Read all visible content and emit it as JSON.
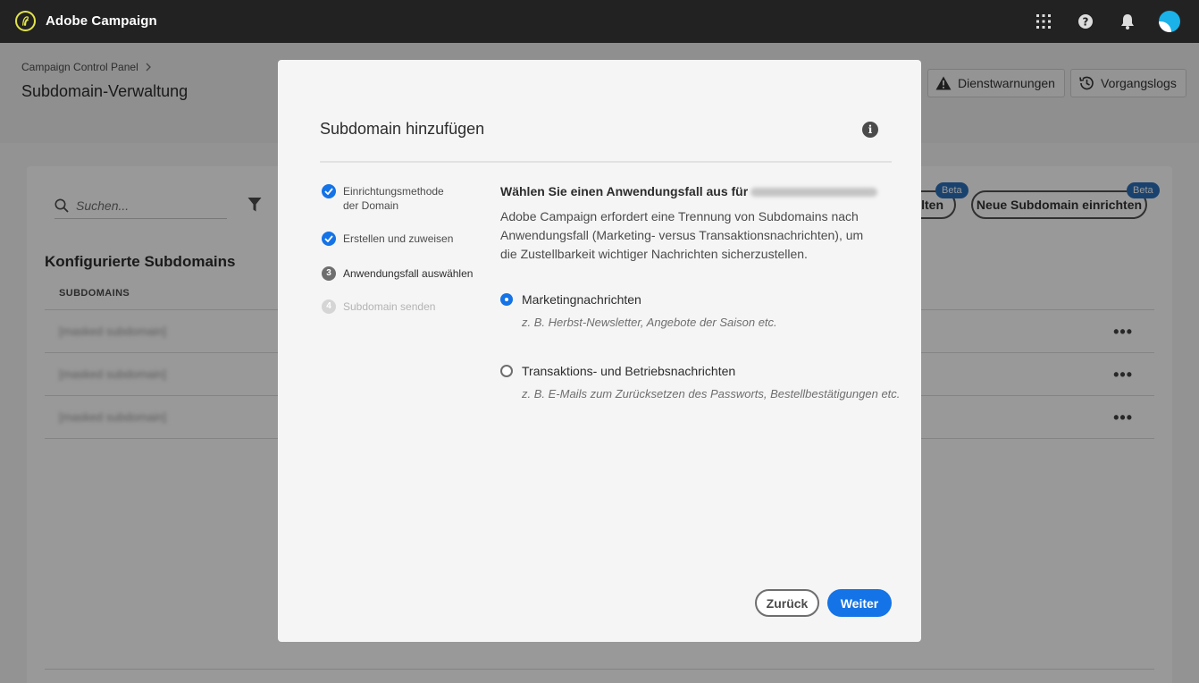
{
  "app": {
    "title": "Adobe Campaign"
  },
  "topbar": {
    "icons": [
      "apps-grid-icon",
      "help-icon",
      "notifications-bell-icon",
      "user-avatar"
    ]
  },
  "header": {
    "breadcrumb": "Campaign Control Panel",
    "title": "Subdomain-Verwaltung",
    "buttons": {
      "alerts": "Dienstwarnungen",
      "logs": "Vorgangslogs"
    }
  },
  "main": {
    "search_placeholder": "Suchen...",
    "section_title": "Konfigurierte Subdomains",
    "column_header": "SUBDOMAINS",
    "rows": [
      {
        "value": "[masked subdomain]",
        "actions": "•••"
      },
      {
        "value": "[masked subdomain]",
        "actions": "•••"
      },
      {
        "value": "[masked subdomain]",
        "actions": "•••"
      }
    ],
    "partial_button": "lten",
    "new_subdomain_button": "Neue Subdomain einrichten",
    "beta_badge": "Beta"
  },
  "modal": {
    "title": "Subdomain hinzufügen",
    "steps": [
      {
        "label": "Einrichtungsmethode der Domain",
        "state": "done"
      },
      {
        "label": "Erstellen und zuweisen",
        "state": "done"
      },
      {
        "number": "3",
        "label": "Anwendungsfall auswählen",
        "state": "active"
      },
      {
        "number": "4",
        "label": "Subdomain senden",
        "state": "pending"
      }
    ],
    "question": "Wählen Sie einen Anwendungsfall aus für",
    "description": "Adobe Campaign erfordert eine Trennung von Subdomains nach Anwendungsfall (Marketing- versus Transaktionsnachrichten), um die Zustellbarkeit wichtiger Nachrichten sicherzustellen.",
    "options": [
      {
        "label": "Marketingnachrichten",
        "hint": "z. B. Herbst-Newsletter, Angebote der Saison etc.",
        "selected": true
      },
      {
        "label": "Transaktions- und Betriebsnachrichten",
        "hint": "z. B. E-Mails zum Zurücksetzen des Passworts, Bestellbestätigungen etc.",
        "selected": false
      }
    ],
    "buttons": {
      "back": "Zurück",
      "next": "Weiter"
    }
  },
  "colors": {
    "accent": "#1473e6",
    "topbar": "#222222",
    "beta": "#2c6fb8",
    "logo_ring": "#e1e44b"
  }
}
